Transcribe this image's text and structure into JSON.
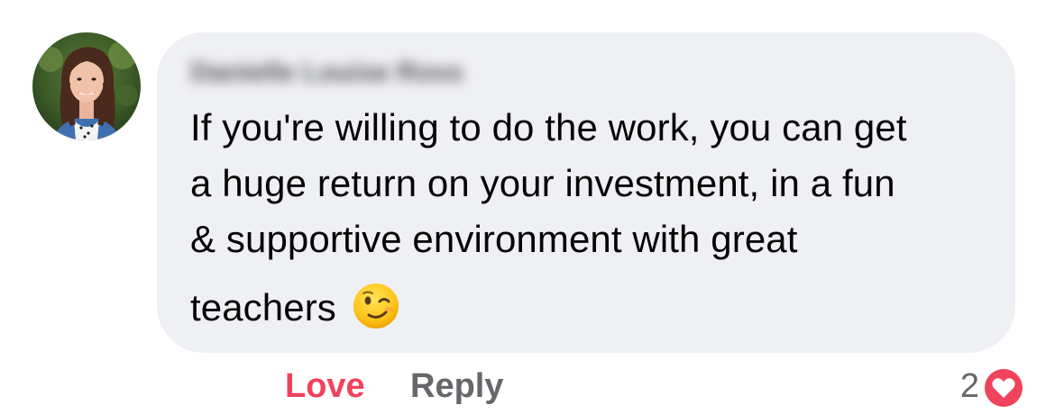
{
  "comment": {
    "author_name": "Danielle Louise Ross",
    "lines": [
      "If you're willing to do the work, you can get",
      "a huge return on your investment, in a fun",
      "& supportive environment with great",
      "teachers"
    ],
    "emoji_icon": "winking-face-emoji"
  },
  "actions": {
    "love_label": "Love",
    "reply_label": "Reply",
    "love_color": "#f0435c",
    "reply_color": "#65676b"
  },
  "reactions": {
    "count": "2",
    "icon": "heart-reaction-icon",
    "icon_color": "#f0435c"
  },
  "theme": {
    "bubble_color": "#eff0f4",
    "text_color": "#050505"
  }
}
